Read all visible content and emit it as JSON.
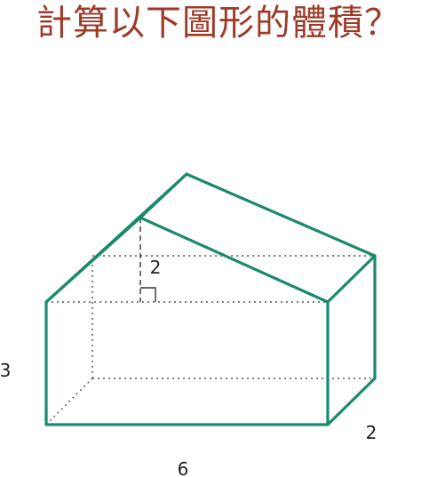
{
  "title": "計算以下圖形的體積？",
  "labels": {
    "height_3": "3",
    "width_6": "6",
    "depth_2": "2",
    "rise_2": "2"
  },
  "colors": {
    "title": "#9e3a28",
    "edge": "#1a8a6e",
    "hidden": "#555555"
  }
}
